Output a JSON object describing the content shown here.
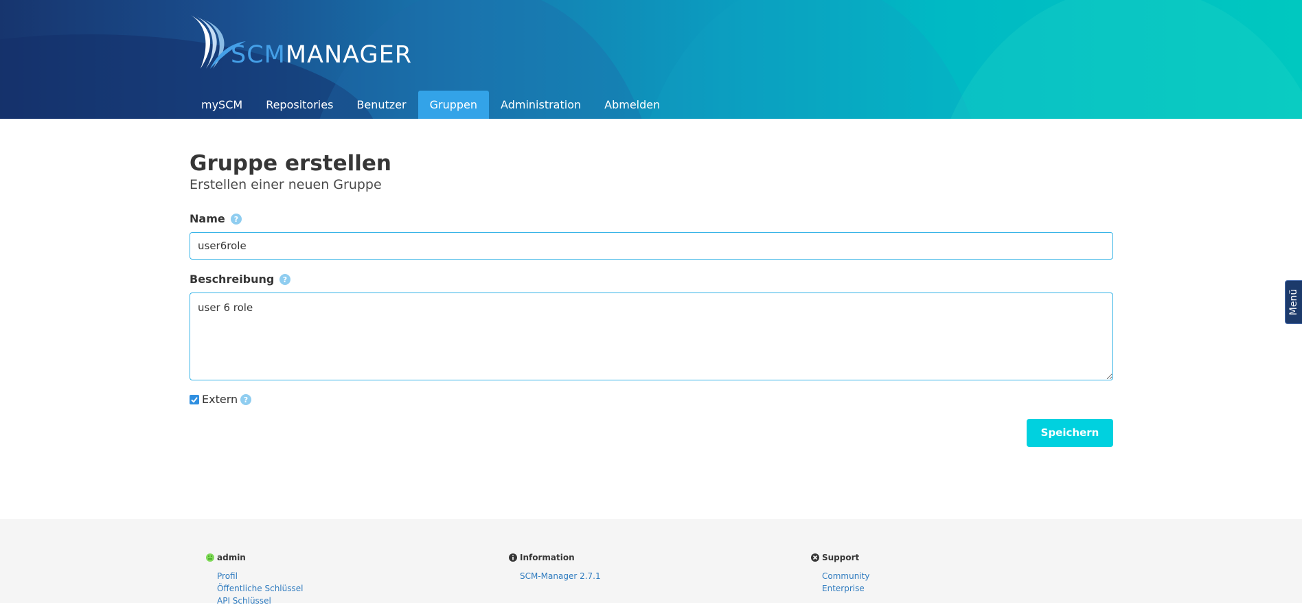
{
  "header": {
    "logo_prefix": "SCM",
    "logo_suffix": "MANAGER",
    "nav": [
      {
        "label": "mySCM"
      },
      {
        "label": "Repositories"
      },
      {
        "label": "Benutzer"
      },
      {
        "label": "Gruppen",
        "active": true
      },
      {
        "label": "Administration"
      },
      {
        "label": "Abmelden"
      }
    ]
  },
  "form": {
    "title": "Gruppe erstellen",
    "subtitle": "Erstellen einer neuen Gruppe",
    "name_label": "Name",
    "name_value": "user6role",
    "description_label": "Beschreibung",
    "description_value": "user 6 role",
    "extern_label": "Extern",
    "extern_checked": true,
    "save_label": "Speichern"
  },
  "side_menu": {
    "label": "Menü"
  },
  "footer": {
    "user": {
      "title": "admin",
      "links": [
        "Profil",
        "Öffentliche Schlüssel",
        "API Schlüssel"
      ]
    },
    "information": {
      "title": "Information",
      "links": [
        "SCM-Manager 2.7.1"
      ]
    },
    "support": {
      "title": "Support",
      "links": [
        "Community",
        "Enterprise"
      ]
    }
  },
  "colors": {
    "accent": "#33a3e8",
    "button": "#00d1df",
    "input_border": "#33b2e6",
    "link": "#2f7bbf"
  }
}
